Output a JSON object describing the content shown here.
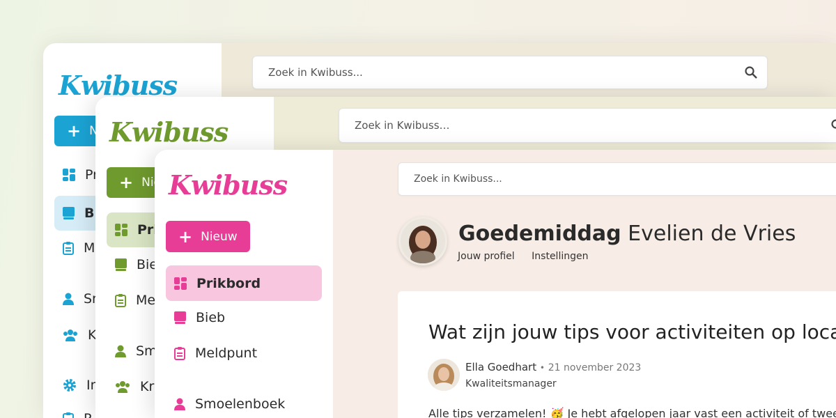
{
  "search": {
    "placeholder": "Zoek in Kwibuss..."
  },
  "search_green": {
    "placeholder": "Zoek in Kwibuss…"
  },
  "logo": {
    "text": "Kwibuss"
  },
  "colors": {
    "blue": "#1ba3d3",
    "green": "#6f9a2e",
    "pink": "#e83d96",
    "pink_active": "#f8c6df",
    "green_active": "#d9e5c4",
    "blue_active": "#d6ecf6"
  },
  "nav": {
    "new_label": "Nieuw",
    "prikbord": "Prikbord",
    "bieb": "Bieb",
    "meldpunt": "Meldpunt",
    "smoelenboek": "Smoelenboek",
    "kringen": "Kringen",
    "instellingen": "Instellingen"
  },
  "blue_window": {
    "new_label": "+ N",
    "prikbord": "Pr",
    "bieb": "Bi",
    "meldpunt": "M",
    "smoelenboek": "Sr",
    "kringen": "Kr",
    "instellingen": "In",
    "extra": "P"
  },
  "green_window": {
    "new_label": "Nie",
    "prikbord": "Prik",
    "bieb": "Bie",
    "meldpunt": "Me",
    "smoelenboek": "Sm",
    "kringen": "Krin"
  },
  "greeting": {
    "prefix": "Goedemiddag",
    "name": "Evelien de Vries"
  },
  "profile_links": {
    "profile": "Jouw profiel",
    "settings": "Instellingen"
  },
  "post": {
    "title": "Wat zijn jouw tips voor activiteiten op locatie?",
    "author": "Ella Goedhart",
    "separator": "•",
    "date": "21 november 2023",
    "role": "Kwaliteitsmanager",
    "body": "Alle tips verzamelen! 🥳 Je hebt afgelopen jaar vast een activiteit of twee"
  }
}
